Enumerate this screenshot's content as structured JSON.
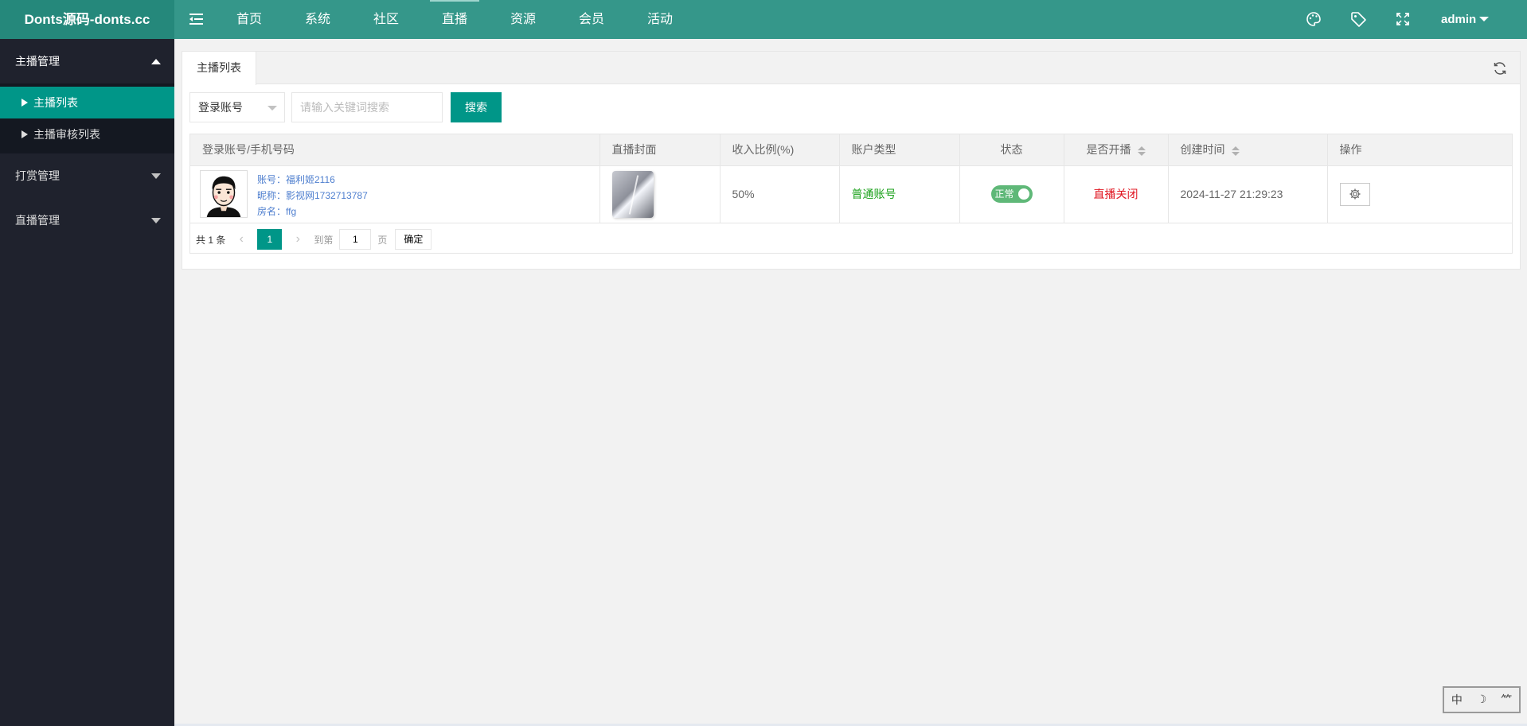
{
  "header": {
    "logo": "Donts源码-donts.cc",
    "nav": [
      "首页",
      "系统",
      "社区",
      "直播",
      "资源",
      "会员",
      "活动"
    ],
    "active_nav": "直播",
    "tools": [
      "theme-icon",
      "tag-icon",
      "fullscreen-icon"
    ],
    "user": "admin"
  },
  "sidebar": {
    "groups": [
      {
        "label": "主播管理",
        "expanded": true,
        "items": [
          {
            "label": "主播列表",
            "active": true
          },
          {
            "label": "主播审核列表",
            "active": false
          }
        ]
      },
      {
        "label": "打赏管理",
        "expanded": false
      },
      {
        "label": "直播管理",
        "expanded": false
      }
    ]
  },
  "tabs": {
    "active": "主播列表"
  },
  "filter": {
    "field_select": "登录账号",
    "search_placeholder": "请输入关键词搜索",
    "search_button": "搜索"
  },
  "table": {
    "columns": [
      "登录账号/手机号码",
      "直播封面",
      "收入比例(%)",
      "账户类型",
      "状态",
      "是否开播",
      "创建时间",
      "操作"
    ],
    "rows": [
      {
        "account": "账号：福利姬2116",
        "nickname": "昵称：影视网1732713787",
        "room": "房名：ffg",
        "ratio": "50%",
        "account_type": "普通账号",
        "status": "正常",
        "status_on": true,
        "live": "直播关闭",
        "created": "2024-11-27 21:29:23"
      }
    ]
  },
  "pager": {
    "total": "共 1 条",
    "current": "1",
    "goto_label": "到第",
    "goto_value": "1",
    "page_unit": "页",
    "confirm": "确定"
  },
  "ime": [
    "中",
    "☽",
    "⺮"
  ],
  "colors": {
    "header": "#35978a",
    "logo_bg": "#25887b",
    "sidebar": "#1f222d",
    "accent": "#009688"
  }
}
